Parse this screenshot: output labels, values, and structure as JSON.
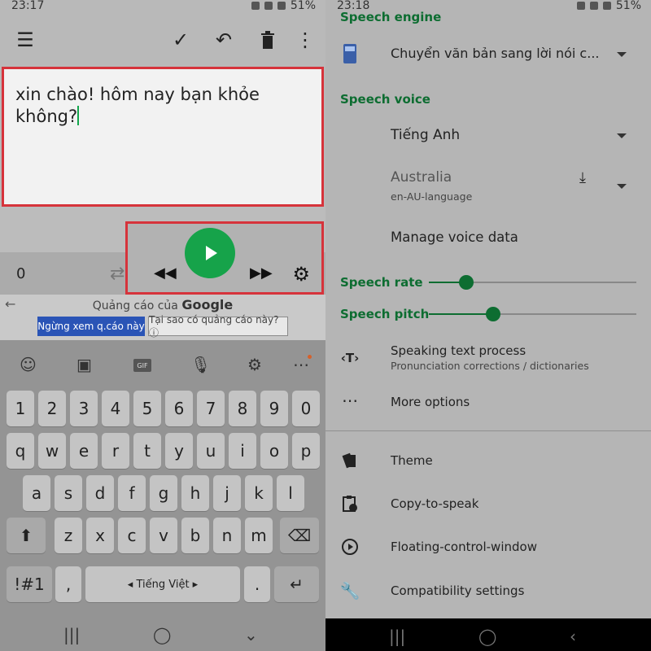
{
  "left": {
    "status": {
      "time": "23:17",
      "battery": "51%"
    },
    "editor_text": "xin chào! hôm nay bạn khỏe không?",
    "counter": "0",
    "ad": {
      "title_prefix": "Quảng cáo của",
      "title_brand": "Google",
      "stop_label": "Ngừng xem q.cáo này",
      "why_label": "Tại sao có quảng cáo này? ⓘ"
    },
    "keyboard": {
      "digits": [
        "1",
        "2",
        "3",
        "4",
        "5",
        "6",
        "7",
        "8",
        "9",
        "0"
      ],
      "row1": [
        "q",
        "w",
        "e",
        "r",
        "t",
        "y",
        "u",
        "i",
        "o",
        "p"
      ],
      "row2": [
        "a",
        "s",
        "d",
        "f",
        "g",
        "h",
        "j",
        "k",
        "l"
      ],
      "row3": [
        "z",
        "x",
        "c",
        "v",
        "b",
        "n",
        "m"
      ],
      "sym_label": "!#1",
      "comma": ",",
      "space_label": "◂ Tiếng Việt ▸",
      "period": "."
    }
  },
  "right": {
    "status": {
      "time": "23:18",
      "battery": "51%"
    },
    "speech_engine_header": "Speech engine",
    "engine_value": "Chuyển văn bản sang lời nói c...",
    "speech_voice_header": "Speech voice",
    "voice_language": "Tiếng Anh",
    "voice_region": "Australia",
    "voice_code": "en-AU-language",
    "manage_voice": "Manage voice data",
    "speech_rate_label": "Speech rate",
    "speech_rate_value": 0.18,
    "speech_pitch_label": "Speech pitch",
    "speech_pitch_value": 0.31,
    "speaking_text_title": "Speaking text process",
    "speaking_text_sub": "Pronunciation corrections / dictionaries",
    "more_options": "More options",
    "theme": "Theme",
    "copy_to_speak": "Copy-to-speak",
    "floating_control": "Floating-control-window",
    "compatibility": "Compatibility settings"
  },
  "colors": {
    "accent": "#0d6d31",
    "play": "#16a34a",
    "highlight_border": "#d6333b",
    "ad_button": "#2a54b6"
  }
}
